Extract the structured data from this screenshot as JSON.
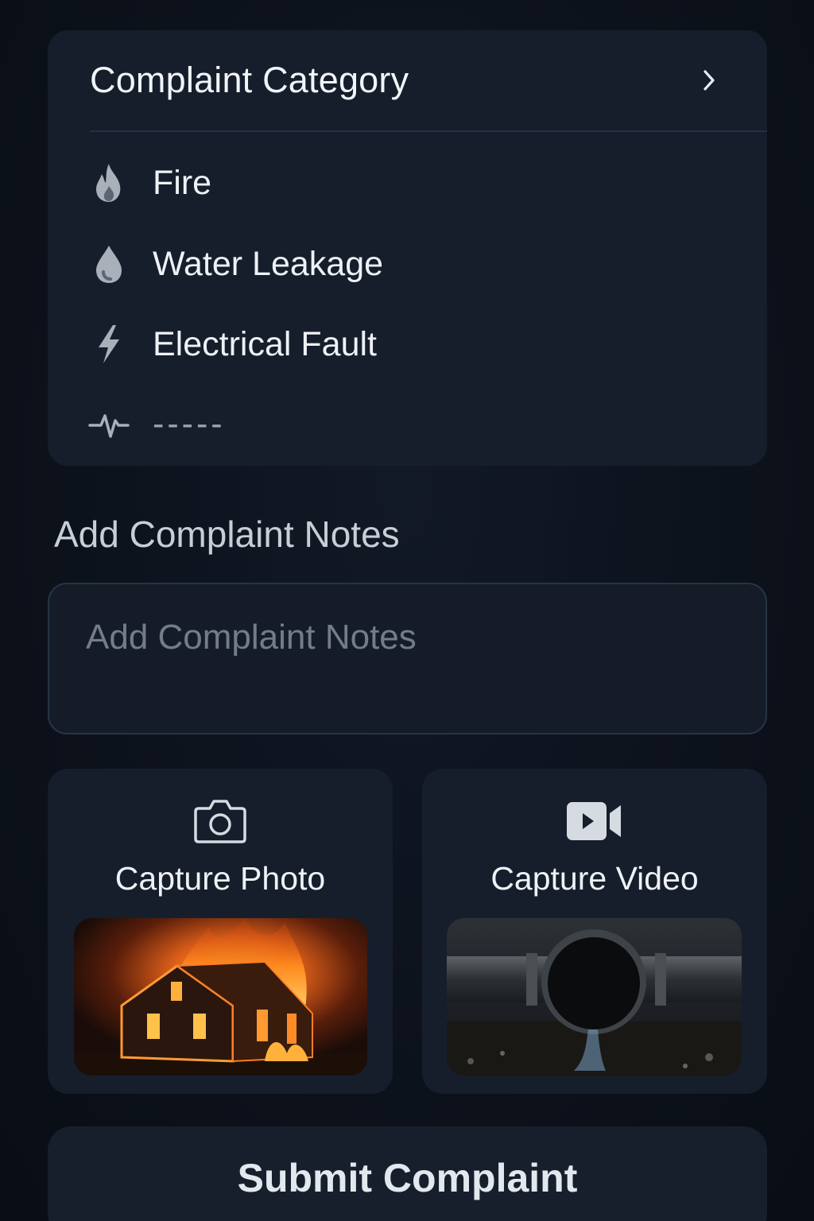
{
  "category": {
    "title": "Complaint Category",
    "chevron_icon": "chevron-right-icon",
    "items": [
      {
        "label": "Fire",
        "icon": "fire-icon"
      },
      {
        "label": "Water Leakage",
        "icon": "water-drop-icon"
      },
      {
        "label": "Electrical Fault",
        "icon": "lightning-icon"
      },
      {
        "label": "-----",
        "icon": "pulse-icon"
      }
    ]
  },
  "notes": {
    "heading": "Add Complaint Notes",
    "placeholder": "Add Complaint Notes",
    "value": ""
  },
  "capture": {
    "photo": {
      "label": "Capture Photo",
      "icon": "camera-icon",
      "thumbnail": "burning-house-image"
    },
    "video": {
      "label": "Capture Video",
      "icon": "video-camera-icon",
      "thumbnail": "leaking-pipe-image"
    }
  },
  "submit": {
    "label": "Submit Complaint"
  },
  "colors": {
    "background": "#0d121b",
    "card": "#161e2b",
    "text": "#eef1f5",
    "muted_icon": "#a9b0ba"
  }
}
